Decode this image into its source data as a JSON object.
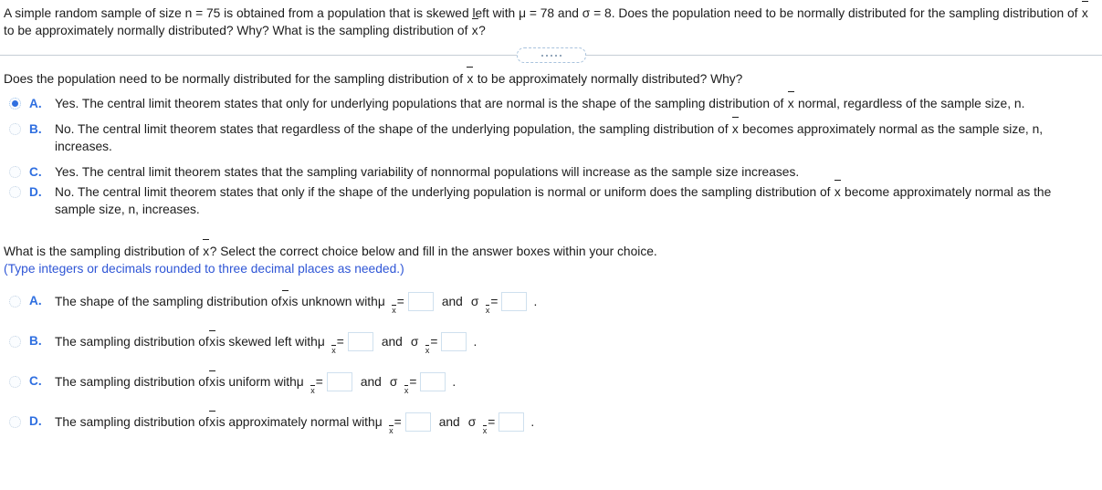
{
  "stem": {
    "line1_a": "A simple random sample of size n = 75 is obtained from a population that is skewed left with ",
    "mu_eq": "μ = 78",
    "and": " and ",
    "sigma_eq": "σ = 8",
    "line1_b": ". Does the population need to be normally distributed for the sampling distribution of ",
    "xbar": "x",
    "line1_c": " to be approximately normally distributed? Why? What is the sampling distribution of ",
    "line1_d": "?"
  },
  "divider": {
    "dot_count": 5,
    "name": "collapse-expand-pill"
  },
  "question1": {
    "prompt_a": "Does the population need to be normally distributed for the sampling distribution of ",
    "prompt_b": " to be approximately normally distributed? Why?",
    "choices": [
      {
        "letter": "A.",
        "selected": true,
        "text_a": "Yes. The central limit theorem states that only for underlying populations that are normal is the shape of the sampling distribution of ",
        "text_b": " normal, regardless of the sample size, n."
      },
      {
        "letter": "B.",
        "selected": false,
        "text_a": "No. The central limit theorem states that regardless of the shape of the underlying population, the sampling distribution of ",
        "text_b": " becomes approximately normal as the sample size, n, increases."
      },
      {
        "letter": "C.",
        "selected": false,
        "text_a": "Yes. The central limit theorem states that the sampling variability of nonnormal populations will increase as the sample size increases.",
        "text_b": ""
      },
      {
        "letter": "D.",
        "selected": false,
        "text_a": "No. The central limit theorem states that only if the shape of the underlying population is normal or uniform does the sampling distribution of ",
        "text_b": " become approximately normal as the sample size, n, increases."
      }
    ]
  },
  "question2": {
    "prompt_a": "What is the sampling distribution of ",
    "prompt_b": "? Select the correct choice below and fill in the answer boxes within your choice.",
    "hint": "(Type integers or decimals rounded to three decimal places as needed.)",
    "mu_symbol": "μ",
    "sigma_symbol": "σ",
    "subscript": "x",
    "equals": "=",
    "and_word": "and",
    "period": ".",
    "choices": [
      {
        "letter": "A.",
        "selected": false,
        "lead": "The shape of the sampling distribution of ",
        "tail": " is unknown with ",
        "mu_value": "",
        "sigma_value": ""
      },
      {
        "letter": "B.",
        "selected": false,
        "lead": "The sampling distribution of ",
        "tail": " is skewed left with ",
        "mu_value": "",
        "sigma_value": ""
      },
      {
        "letter": "C.",
        "selected": false,
        "lead": "The sampling distribution of ",
        "tail": " is uniform with ",
        "mu_value": "",
        "sigma_value": ""
      },
      {
        "letter": "D.",
        "selected": false,
        "lead": "The sampling distribution of ",
        "tail": " is approximately normal with ",
        "mu_value": "",
        "sigma_value": ""
      }
    ]
  },
  "colors": {
    "accent": "#2f6fe0",
    "hint": "#2f56d6",
    "text": "#1c1c1c",
    "divider": "#c6ced6",
    "box_border": "#cfe0ee"
  }
}
